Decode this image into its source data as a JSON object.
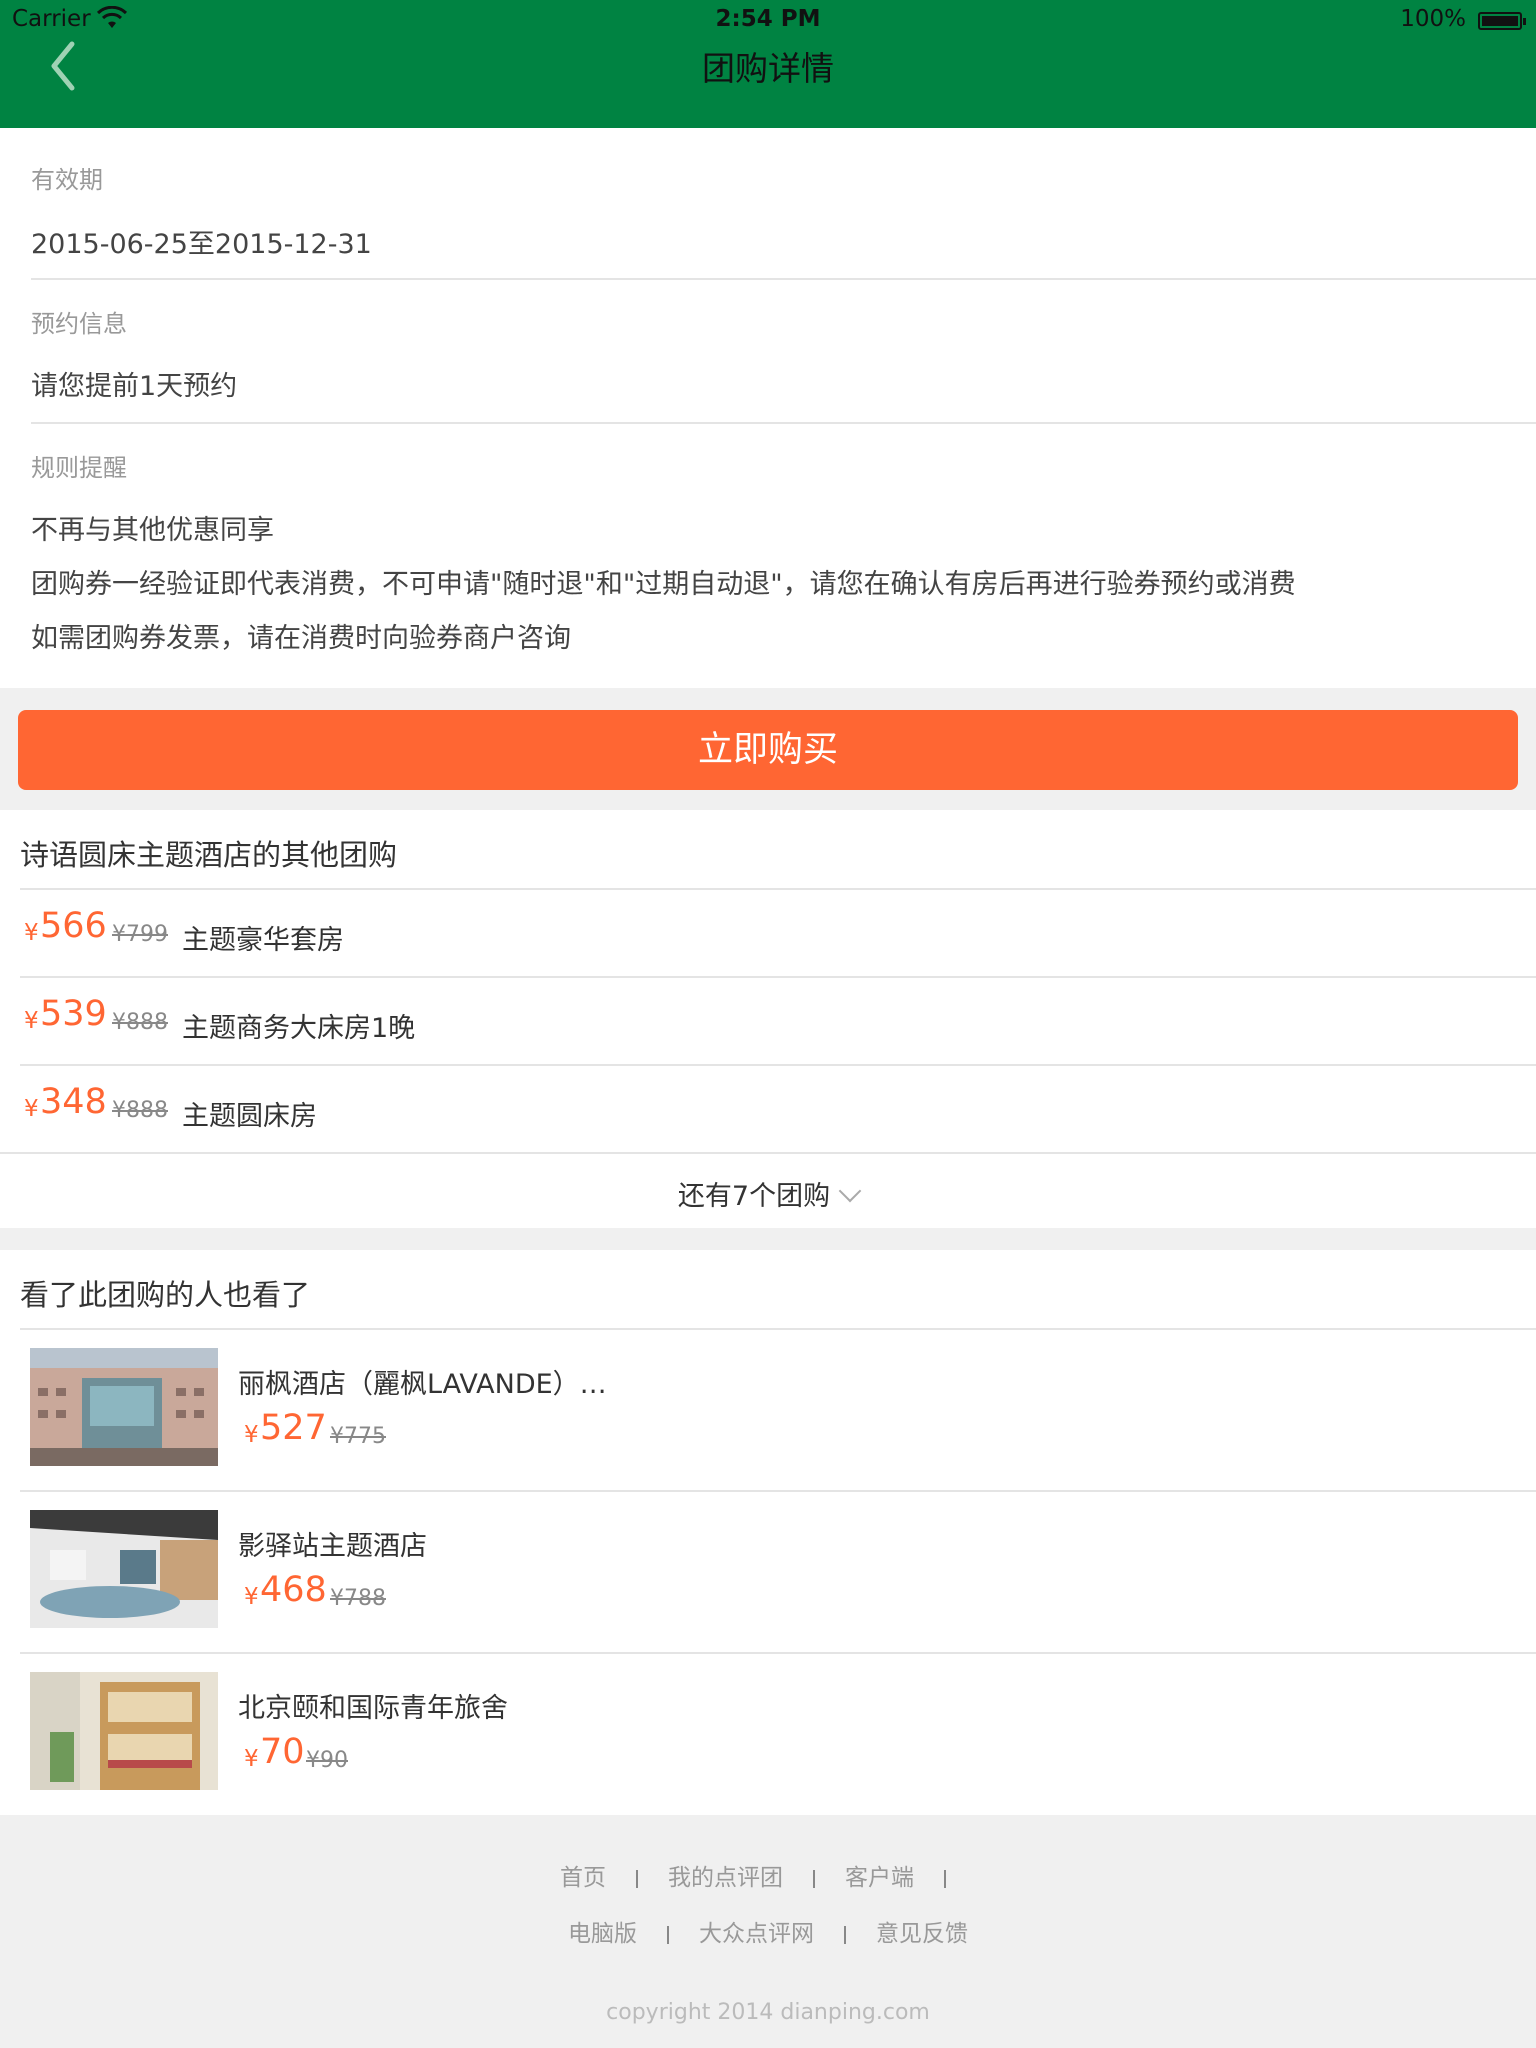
{
  "status_bar": {
    "carrier": "Carrier",
    "time": "2:54 PM",
    "battery": "100%"
  },
  "nav": {
    "title": "团购详情"
  },
  "validity": {
    "label": "有效期",
    "value": "2015-06-25至2015-12-31"
  },
  "booking": {
    "label": "预约信息",
    "value": "请您提前1天预约"
  },
  "rules": {
    "label": "规则提醒",
    "lines": [
      "不再与其他优惠同享",
      "团购券一经验证即代表消费，不可申请\"随时退\"和\"过期自动退\"，请您在确认有房后再进行验券预约或消费",
      "如需团购券发票，请在消费时向验券商户咨询"
    ]
  },
  "buy_button": {
    "label": "立即购买"
  },
  "other_deals": {
    "title": "诗语圆床主题酒店的其他团购",
    "currency": "¥",
    "items": [
      {
        "price": "566",
        "original": "¥799",
        "name": "主题豪华套房"
      },
      {
        "price": "539",
        "original": "¥888",
        "name": "主题商务大床房1晚"
      },
      {
        "price": "348",
        "original": "¥888",
        "name": "主题圆床房"
      }
    ],
    "more": "还有7个团购"
  },
  "also_viewed": {
    "title": "看了此团购的人也看了",
    "currency": "¥",
    "items": [
      {
        "name": "丽枫酒店（麗枫LAVANDE）…",
        "price": "527",
        "original": "¥775"
      },
      {
        "name": "影驿站主题酒店",
        "price": "468",
        "original": "¥788"
      },
      {
        "name": "北京颐和国际青年旅舍",
        "price": "70",
        "original": "¥90"
      }
    ]
  },
  "footer": {
    "row1": [
      "首页",
      "我的点评团",
      "客户端"
    ],
    "row2": [
      "电脑版",
      "大众点评网",
      "意见反馈"
    ],
    "copyright": "copyright 2014 dianping.com"
  },
  "colors": {
    "nav_green": "#008342",
    "accent_orange": "#ff6633"
  }
}
